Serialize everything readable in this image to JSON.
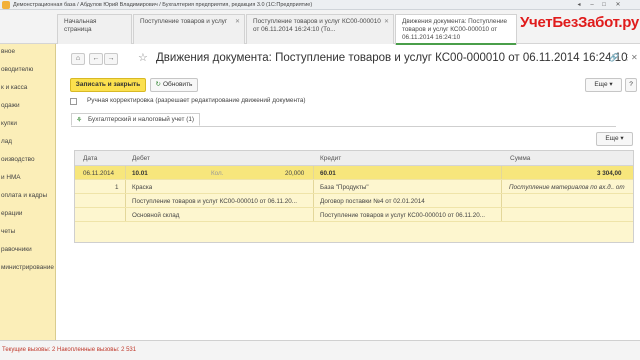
{
  "window": {
    "title": "Демонстрационная база / Абдулов Юрий Владимирович / Бухгалтерия предприятия, редакция 3.0  (1С:Предприятие)"
  },
  "tabs": [
    {
      "label": "Начальная страница"
    },
    {
      "label": "Поступление товаров и услуг"
    },
    {
      "label": "Поступление товаров и услуг КС00-000010 от 06.11.2014 16:24:10 (То..."
    },
    {
      "label": "Движения документа: Поступление товаров и услуг КС00-000010 от 06.11.2014 16:24:10"
    }
  ],
  "brand": "УчетБезЗабот.ру",
  "sidebar": {
    "items": [
      {
        "label": "вное"
      },
      {
        "label": "оводителю"
      },
      {
        "label": "к и касса"
      },
      {
        "label": "одажи"
      },
      {
        "label": "купки"
      },
      {
        "label": "лад"
      },
      {
        "label": "оизводство"
      },
      {
        "label": "и НМА"
      },
      {
        "label": "оплата и кадры"
      },
      {
        "label": "ерации"
      },
      {
        "label": "четы"
      },
      {
        "label": "равочники"
      },
      {
        "label": "министрирование"
      }
    ]
  },
  "document": {
    "title": "Движения документа: Поступление товаров и услуг КС00-000010 от 06.11.2014 16:24:10"
  },
  "toolbar": {
    "save_close": "Записать и закрыть",
    "refresh": "Обновить",
    "more": "Еще",
    "help": "?"
  },
  "manual_edit": {
    "label": "Ручная корректировка (разрешает редактирование движений документа)",
    "checked": false
  },
  "subtab": {
    "label": "Бухгалтерский и налоговый учет (1)"
  },
  "table": {
    "more": "Еще",
    "columns": {
      "date": "Дата",
      "debit": "Дебет",
      "credit": "Кредит",
      "amount": "Сумма"
    },
    "rows": [
      {
        "date": "06.11.2014",
        "debit": "10.01",
        "qty_label": "Кол.",
        "qty": "20,000",
        "credit": "60.01",
        "amount": "3 304,00"
      },
      {
        "date": "1",
        "debit": "Краска",
        "credit": "База \"Продукты\"",
        "amount": "Поступление материалов по вх.д.. от"
      },
      {
        "date": "",
        "debit": "Поступление товаров и услуг КС00-000010 от 06.11.20...",
        "credit": "Договор поставки №4 от 02.01.2014",
        "amount": ""
      },
      {
        "date": "",
        "debit": "Основной склад",
        "credit": "Поступление товаров и услуг КС00-000010 от 06.11.20...",
        "amount": ""
      }
    ]
  },
  "status": {
    "text": "Текущие вызовы: 2  Накопленные вызовы: 2 531"
  }
}
